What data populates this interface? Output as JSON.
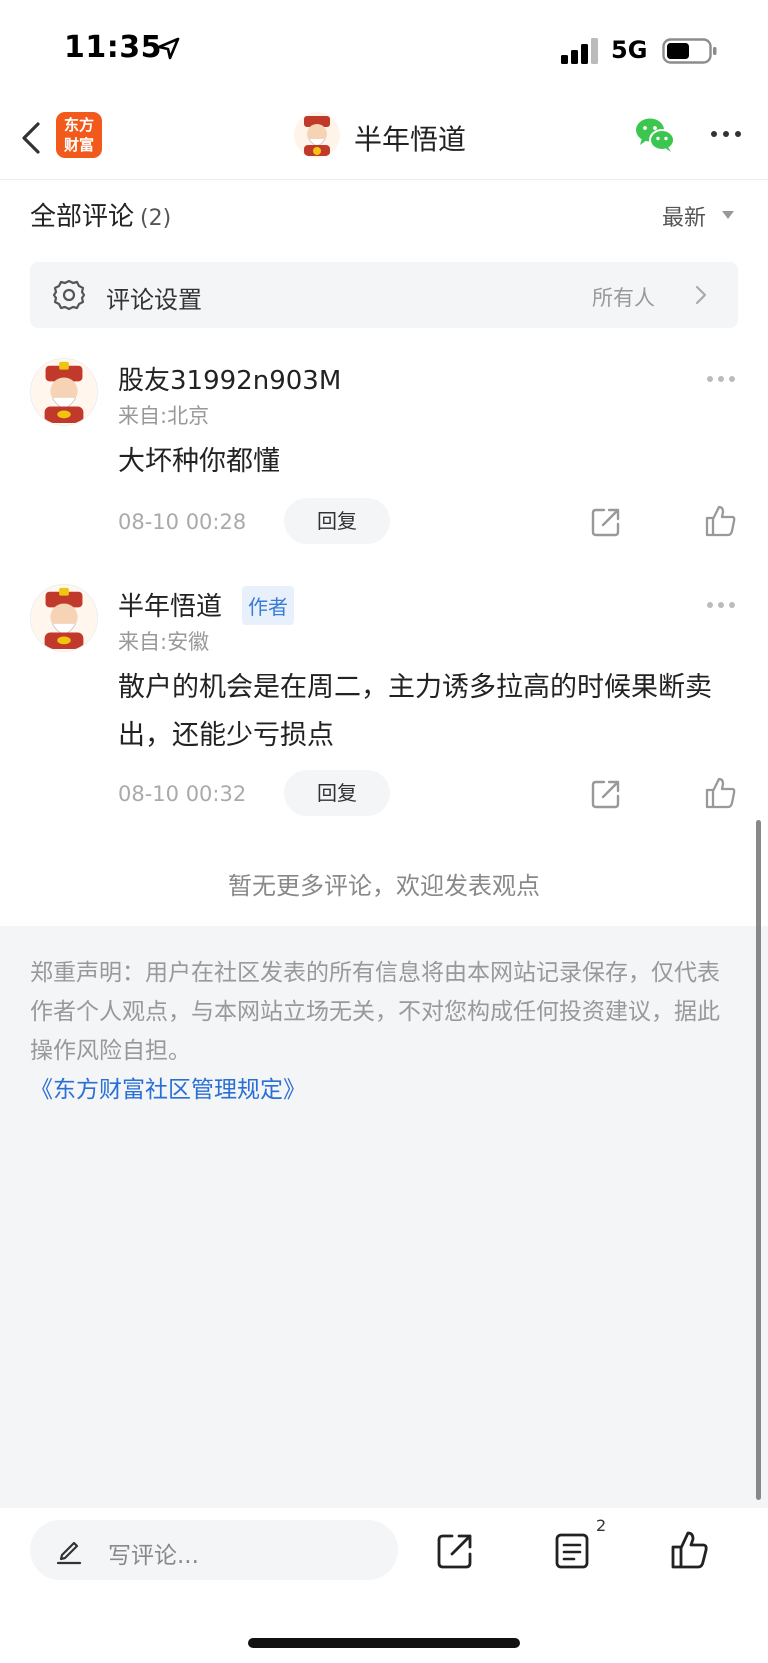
{
  "status_bar": {
    "time": "11:35",
    "network": "5G"
  },
  "nav": {
    "logo_line1": "东方",
    "logo_line2": "财富",
    "title": "半年悟道"
  },
  "comments_header": {
    "title": "全部评论",
    "count": "(2)",
    "sort": "最新"
  },
  "settings": {
    "label": "评论设置",
    "value": "所有人"
  },
  "comments": [
    {
      "name": "股友31992n903M",
      "location": "来自:北京",
      "text": "大坏种你都懂",
      "time": "08-10 00:28",
      "reply": "回复",
      "badge": ""
    },
    {
      "name": "半年悟道",
      "location": "来自:安徽",
      "text": "散户的机会是在周二，主力诱多拉高的时候果断卖出，还能少亏损点",
      "time": "08-10 00:32",
      "reply": "回复",
      "badge": "作者"
    }
  ],
  "no_more": "暂无更多评论，欢迎发表观点",
  "disclaimer": {
    "text": "郑重声明：用户在社区发表的所有信息将由本网站记录保存，仅代表作者个人观点，与本网站立场无关，不对您构成任何投资建议，据此操作风险自担。",
    "link": "《东方财富社区管理规定》"
  },
  "bottom_bar": {
    "placeholder": "写评论...",
    "comment_count": "2"
  },
  "colors": {
    "brand": "#f25a1c",
    "link": "#2a6fd6",
    "wechat": "#3cc64f",
    "panel_bg": "#f4f5f7"
  },
  "icons": [
    "location-arrow-icon",
    "signal-icon",
    "battery-icon",
    "back-chevron-icon",
    "wechat-icon",
    "more-icon",
    "gear-icon",
    "chevron-right-icon",
    "share-icon",
    "thumbs-up-icon",
    "pen-icon",
    "list-icon"
  ]
}
